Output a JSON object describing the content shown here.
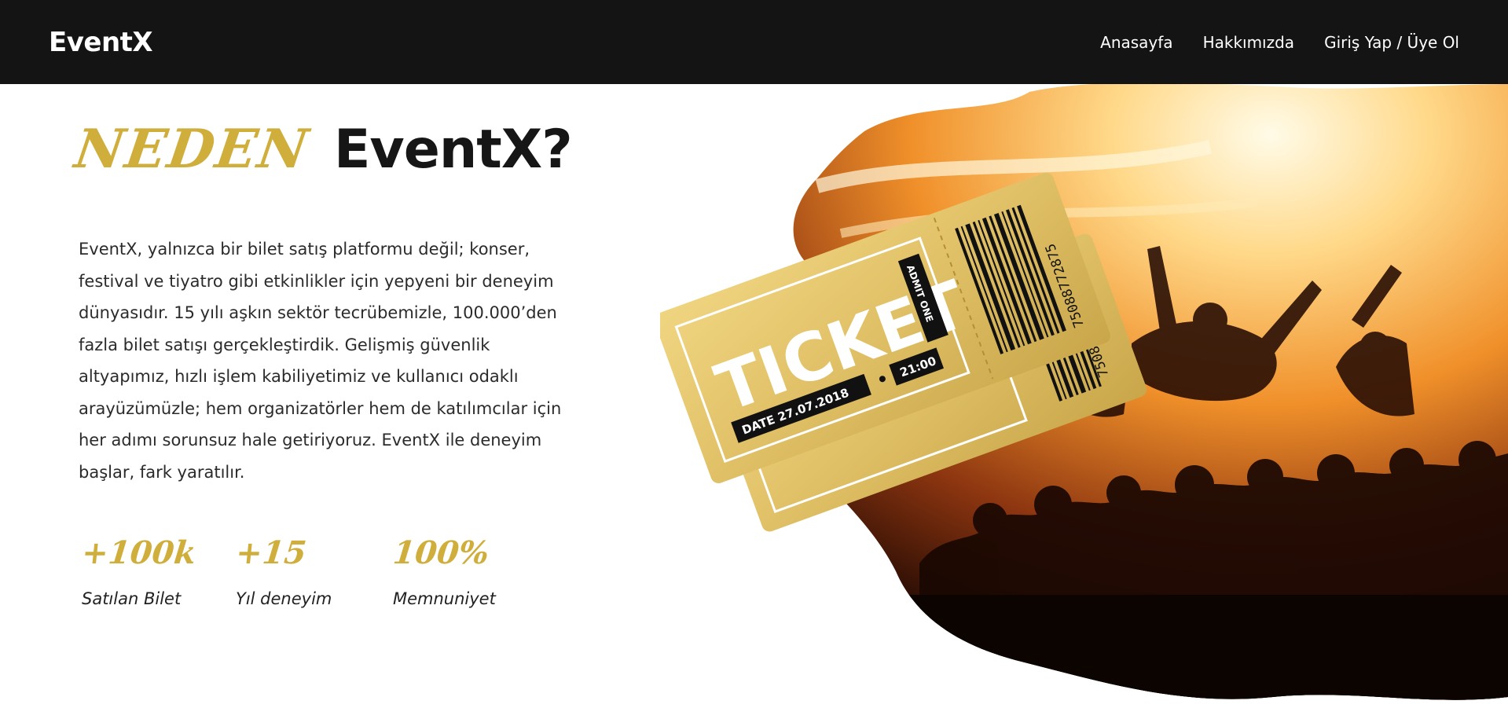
{
  "header": {
    "brand": "EventX",
    "nav": [
      {
        "label": "Anasayfa"
      },
      {
        "label": "Hakkımızda"
      },
      {
        "label": "Giriş Yap / Üye Ol"
      }
    ]
  },
  "hero": {
    "accent_word": "NEDEN",
    "title": "EventX?",
    "description": "EventX, yalnızca bir bilet satış platformu değil; konser, festival ve tiyatro gibi etkinlikler için yepyeni bir deneyim dünyasıdır. 15 yılı aşkın sektör tecrübemizle, 100.000’den fazla bilet satışı gerçekleştirdik. Gelişmiş güvenlik altyapımız, hızlı işlem kabiliyetimiz ve kullanıcı odaklı arayüzümüzle; hem organizatörler hem de katılımcılar için her adımı sorunsuz hale getiriyoruz. EventX ile deneyim başlar, fark yaratılır.",
    "stats": [
      {
        "value": "+100k",
        "label": "Satılan Bilet"
      },
      {
        "value": "+15",
        "label": "Yıl deneyim"
      },
      {
        "value": "100%",
        "label": "Memnuniyet"
      }
    ]
  },
  "ticket": {
    "word": "TICKET",
    "admit": "ADMIT ONE",
    "date": "DATE 27.07.2018",
    "time": "21:00",
    "serial_front": "75088772875",
    "serial_back": "75085774873"
  },
  "colors": {
    "accent_gold": "#cfae3c",
    "header_bg": "#141414",
    "ticket_gold": "#e0c066"
  }
}
